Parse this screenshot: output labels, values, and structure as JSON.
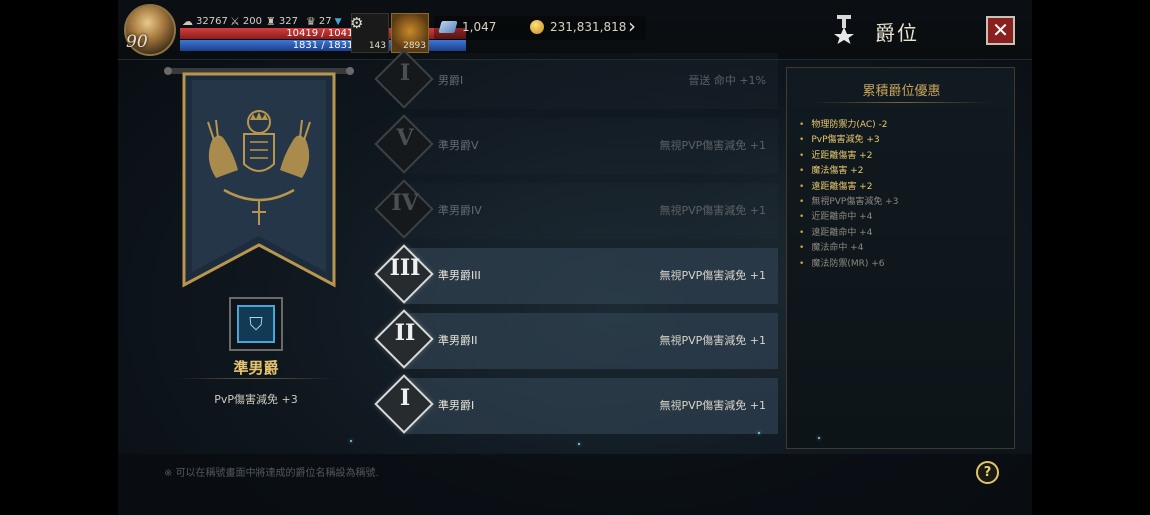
{
  "player": {
    "level": "90",
    "stat_a": "32767",
    "stat_b": "200",
    "stat_c": "327",
    "stat_d": "27",
    "hp": "10419 / 10419",
    "mp": "1831 / 1831",
    "slot1_count": "143",
    "slot2_count": "2893"
  },
  "currency": {
    "diamonds": "1,047",
    "gold": "231,831,818"
  },
  "header": {
    "title": "爵位",
    "close_label": "✕"
  },
  "current_rank": {
    "name": "準男爵",
    "bonus": "PvP傷害減免 +3"
  },
  "ranks": [
    {
      "numeral": "I",
      "name": "男爵I",
      "bonus": "晉送 命中 +1%",
      "active": false
    },
    {
      "numeral": "V",
      "name": "準男爵V",
      "bonus": "無視PVP傷害減免 +1",
      "active": false
    },
    {
      "numeral": "IV",
      "name": "準男爵IV",
      "bonus": "無視PVP傷害減免 +1",
      "active": false
    },
    {
      "numeral": "III",
      "name": "準男爵III",
      "bonus": "無視PVP傷害減免 +1",
      "active": true
    },
    {
      "numeral": "II",
      "name": "準男爵II",
      "bonus": "無視PVP傷害減免 +1",
      "active": true
    },
    {
      "numeral": "I",
      "name": "準男爵I",
      "bonus": "無視PVP傷害減免 +1",
      "active": true
    }
  ],
  "cumulative": {
    "title": "累積爵位優惠",
    "items": [
      {
        "text": "物理防禦力(AC) -2",
        "highlight": true
      },
      {
        "text": "PvP傷害減免 +3",
        "highlight": true
      },
      {
        "text": "近距離傷害 +2",
        "highlight": true
      },
      {
        "text": "魔法傷害 +2",
        "highlight": true
      },
      {
        "text": "遠距離傷害 +2",
        "highlight": true
      },
      {
        "text": "無視PVP傷害減免 +3",
        "highlight": false
      },
      {
        "text": "近距離命中 +4",
        "highlight": false
      },
      {
        "text": "遠距離命中 +4",
        "highlight": false
      },
      {
        "text": "魔法命中 +4",
        "highlight": false
      },
      {
        "text": "魔法防禦(MR) +6",
        "highlight": false
      }
    ]
  },
  "footer": {
    "note": "※ 可以在稱號畫面中將達成的爵位名稱設為稱號.",
    "help_label": "?"
  },
  "colors": {
    "accent_gold": "#e6c46e",
    "hp_red": "#d23d3d",
    "mp_blue": "#3b78d8",
    "close_red": "#8a1f1f"
  }
}
